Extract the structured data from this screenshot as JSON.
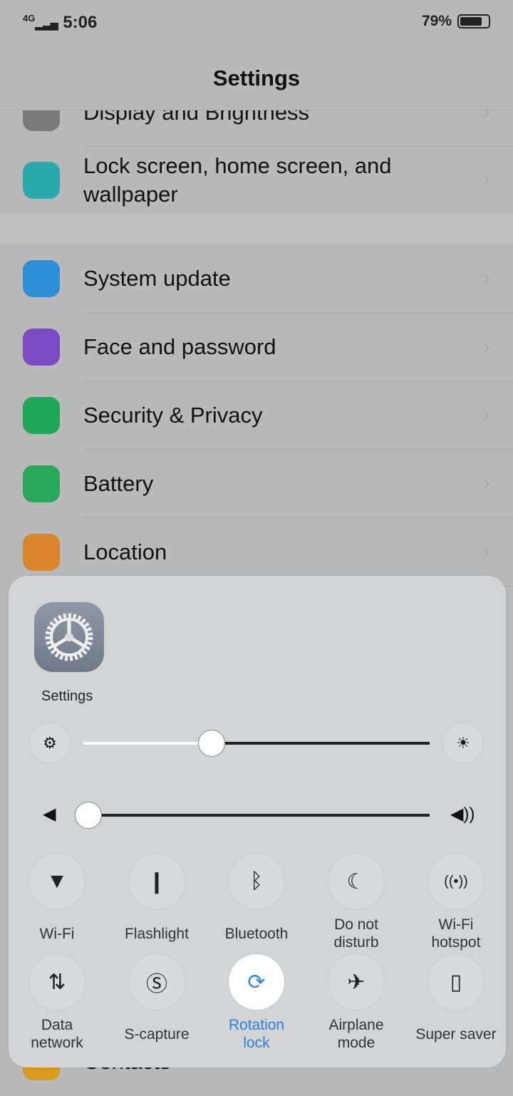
{
  "status_bar": {
    "network": "4G",
    "time": "5:06",
    "battery": "79%"
  },
  "header": {
    "title": "Settings"
  },
  "list": [
    {
      "label": "Display and Brightness",
      "icon": "display-brightness-icon",
      "color": "#7a7a7a"
    },
    {
      "label": "Lock screen, home screen, and wallpaper",
      "icon": "palette-icon",
      "color": "#2aa9aa"
    },
    {
      "label": "System update",
      "icon": "system-update-icon",
      "color": "#2d8fd5"
    },
    {
      "label": "Face and password",
      "icon": "face-icon",
      "color": "#7b4bc4"
    },
    {
      "label": "Security & Privacy",
      "icon": "shield-icon",
      "color": "#1fa75a"
    },
    {
      "label": "Battery",
      "icon": "battery-icon",
      "color": "#27a85a"
    },
    {
      "label": "Location",
      "icon": "location-icon",
      "color": "#d9862a"
    },
    {
      "label": "Contacts",
      "icon": "contacts-icon",
      "color": "#d99a20"
    }
  ],
  "panel": {
    "app_label": "Settings",
    "brightness": {
      "value": 0.37
    },
    "volume": {
      "value": 0.0
    },
    "toggles": [
      {
        "label": "Wi-Fi",
        "icon": "wifi-icon",
        "glyph": "▼",
        "on": false
      },
      {
        "label": "Flashlight",
        "icon": "flashlight-icon",
        "glyph": "❙",
        "on": false
      },
      {
        "label": "Bluetooth",
        "icon": "bluetooth-icon",
        "glyph": "ᛒ",
        "on": false
      },
      {
        "label": "Do not disturb",
        "icon": "moon-icon",
        "glyph": "☾",
        "on": false
      },
      {
        "label": "Wi-Fi hotspot",
        "icon": "hotspot-icon",
        "glyph": "((•))",
        "on": false
      },
      {
        "label": "Data network",
        "icon": "data-network-icon",
        "glyph": "⇅",
        "on": false
      },
      {
        "label": "S-capture",
        "icon": "screenshot-icon",
        "glyph": "Ⓢ",
        "on": false
      },
      {
        "label": "Rotation lock",
        "icon": "rotation-lock-icon",
        "glyph": "⟳",
        "on": true
      },
      {
        "label": "Airplane mode",
        "icon": "airplane-icon",
        "glyph": "✈",
        "on": false
      },
      {
        "label": "Super saver",
        "icon": "super-saver-icon",
        "glyph": "▯",
        "on": false
      }
    ],
    "accent": "#2f8ae0"
  }
}
